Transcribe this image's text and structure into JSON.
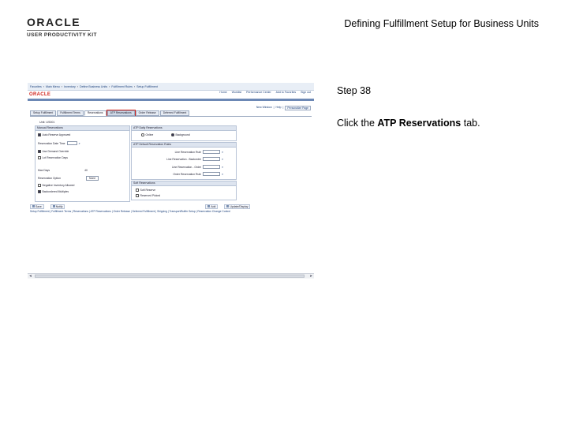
{
  "header": {
    "logo_brand": "ORACLE",
    "logo_product": "USER PRODUCTIVITY KIT",
    "doc_title": "Defining Fulfillment Setup for Business Units"
  },
  "step": {
    "label": "Step 38"
  },
  "instruction": {
    "prefix": "Click the ",
    "target": "ATP Reservations",
    "suffix": " tab."
  },
  "screenshot": {
    "nav_items": [
      "Favorites",
      "Main Menu",
      "Inventory",
      "Define Business Units",
      "Fulfillment Rules",
      "Setup Fulfillment"
    ],
    "brand": "ORACLE",
    "top_links": [
      "Home",
      "Worklist",
      "Performance Center",
      "Add to Favorites",
      "Sign out"
    ],
    "page_links": [
      "New Window",
      "Help",
      "Personalize Page"
    ],
    "tabs": [
      {
        "label": "Setup Fulfillment",
        "state": "normal"
      },
      {
        "label": "Fulfillment Terms",
        "state": "normal"
      },
      {
        "label": "Reservations",
        "state": "active"
      },
      {
        "label": "ATP Reservations",
        "state": "highlight"
      },
      {
        "label": "Order Release",
        "state": "normal"
      },
      {
        "label": "Deferred Fulfillment",
        "state": "normal"
      }
    ],
    "unit_label": "Unit:",
    "unit_value": "US001",
    "manual_group": {
      "title": "Manual Reservations",
      "rows": [
        {
          "label": "Auto Reserve Approved",
          "checked": true
        },
        {
          "label": "Reservation Date Time",
          "checked": false
        },
        {
          "label": "Use Demand Override",
          "checked": true
        },
        {
          "label": "Lot Reservation Days",
          "checked": false
        }
      ],
      "max_days_label": "Max Days",
      "max_days_value": "40",
      "ext_label": "Reservation Option",
      "ext_value": "None",
      "extra_rows": [
        {
          "label": "Negative Inventory Allowed",
          "checked": false
        },
        {
          "label": "Backordered Multiples",
          "checked": true
        }
      ]
    },
    "atp_group": {
      "title": "ATP Daily Reservations",
      "options": [
        {
          "label": "Online",
          "selected": false
        },
        {
          "label": "Background",
          "selected": true
        }
      ]
    },
    "defaults_group": {
      "title": "ATP Default Reservation Rules",
      "fields": [
        "Line Reservation Rule",
        "Line Reservation - Backorder",
        "Line Reservation - Order",
        "Order Reservation Rule"
      ]
    },
    "soft_group": {
      "title": "Soft Reservations",
      "rows": [
        {
          "label": "Soft Reserve",
          "checked": false
        },
        {
          "label": "Reserved Picked",
          "checked": false
        }
      ]
    },
    "buttons": [
      "Save",
      "Notify",
      "Add",
      "Update/Display"
    ],
    "footer_links": "Setup Fulfillment | Fulfillment Terms | Reservations | ATP Reservations | Order Release | Deferred Fulfillment | Shipping | Transport/Buffer Setup | Reservation Change Control"
  }
}
